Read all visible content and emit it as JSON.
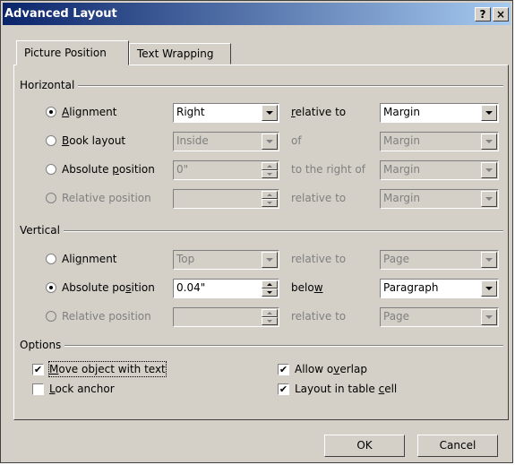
{
  "window": {
    "title": "Advanced Layout",
    "help_label": "?",
    "close_label": "×"
  },
  "tabs": [
    {
      "label": "Picture Position",
      "active": true
    },
    {
      "label": "Text Wrapping",
      "active": false
    }
  ],
  "horizontal": {
    "group_label": "Horizontal",
    "rows": [
      {
        "option": "Alignment",
        "selected": true,
        "enabled": true,
        "value": "Right",
        "relation": "relative to",
        "target": "Margin"
      },
      {
        "option": "Book layout",
        "selected": false,
        "enabled": true,
        "value": "Inside",
        "relation": "of",
        "target": "Margin"
      },
      {
        "option": "Absolute position",
        "selected": false,
        "enabled": true,
        "value": "0\"",
        "relation": "to the right of",
        "target": "Margin"
      },
      {
        "option": "Relative position",
        "selected": false,
        "enabled": false,
        "value": "",
        "relation": "relative to",
        "target": "Margin"
      }
    ]
  },
  "vertical": {
    "group_label": "Vertical",
    "rows": [
      {
        "option": "Alignment",
        "selected": false,
        "enabled": true,
        "value": "Top",
        "relation": "relative to",
        "target": "Page"
      },
      {
        "option": "Absolute position",
        "selected": true,
        "enabled": true,
        "value": "0.04\"",
        "relation": "below",
        "target": "Paragraph"
      },
      {
        "option": "Relative position",
        "selected": false,
        "enabled": false,
        "value": "",
        "relation": "relative to",
        "target": "Page"
      }
    ]
  },
  "options": {
    "group_label": "Options",
    "move_object": {
      "label": "Move object with text",
      "checked": true
    },
    "lock_anchor": {
      "label": "Lock anchor",
      "checked": false
    },
    "allow_overlap": {
      "label": "Allow overlap",
      "checked": true
    },
    "layout_in_cell": {
      "label": "Layout in table cell",
      "checked": true
    }
  },
  "buttons": {
    "ok": "OK",
    "cancel": "Cancel"
  },
  "check_glyph": "✔"
}
